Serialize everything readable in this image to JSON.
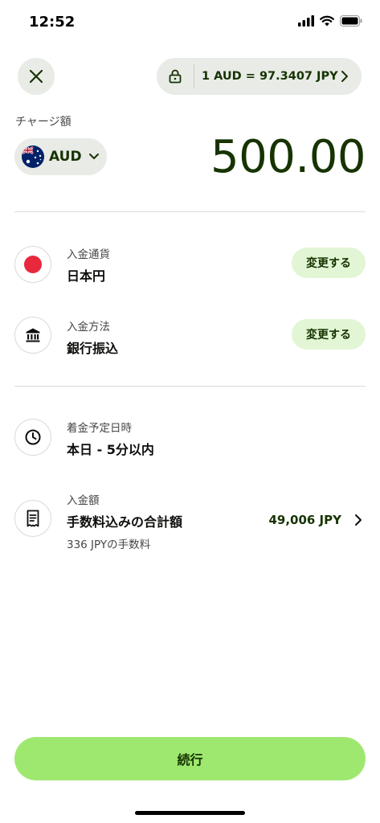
{
  "status_bar": {
    "time": "12:52"
  },
  "header": {
    "close_icon": "close-icon",
    "rate_text": "1 AUD = 97.3407 JPY"
  },
  "charge": {
    "label": "チャージ額",
    "currency_code": "AUD",
    "amount": "500.00"
  },
  "deposit_currency": {
    "label": "入金通貨",
    "value": "日本円",
    "change_label": "変更する"
  },
  "deposit_method": {
    "label": "入金方法",
    "value": "銀行振込",
    "change_label": "変更する"
  },
  "arrival": {
    "label": "着金予定日時",
    "value": "本日 - 5分以内"
  },
  "total": {
    "label": "入金額",
    "value": "手数料込みの合計額",
    "fee": "336 JPYの手数料",
    "amount": "49,006 JPY"
  },
  "footer": {
    "continue_label": "続行"
  },
  "colors": {
    "brand_green": "#9fe870",
    "dark_green": "#163300",
    "pale_green": "#e2f6d5",
    "japan_red": "#e8283c"
  }
}
